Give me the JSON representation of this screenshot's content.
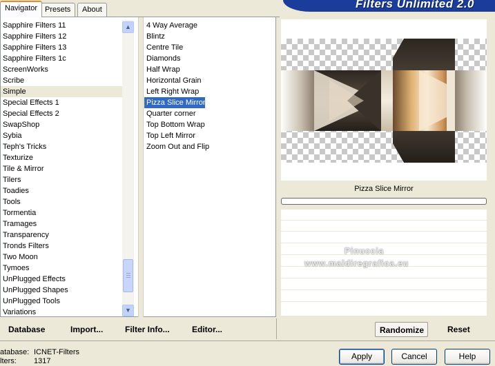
{
  "window": {
    "title": "Filters Unlimited 2.0"
  },
  "tabs": [
    {
      "label": "Navigator",
      "active": true
    },
    {
      "label": "Presets",
      "active": false
    },
    {
      "label": "About",
      "active": false
    }
  ],
  "categories": [
    "Sapphire Filters 11",
    "Sapphire Filters 12",
    "Sapphire Filters 13",
    "Sapphire Filters 1c",
    "ScreenWorks",
    "Scribe",
    "Simple",
    "Special Effects 1",
    "Special Effects 2",
    "SwapShop",
    "Sybia",
    "Teph's Tricks",
    "Texturize",
    "Tile & Mirror",
    "Tilers",
    "Toadies",
    "Tools",
    "Tormentia",
    "Tramages",
    "Transparency",
    "Tronds Filters",
    "Two Moon",
    "Tymoes",
    "UnPlugged Effects",
    "UnPlugged Shapes",
    "UnPlugged Tools",
    "Variations"
  ],
  "selected_category": "Simple",
  "filters": [
    "4 Way Average",
    "Blintz",
    "Centre Tile",
    "Diamonds",
    "Half Wrap",
    "Horizontal Grain",
    "Left Right Wrap",
    "Pizza Slice Mirror",
    "Quarter corner",
    "Top Bottom Wrap",
    "Top Left Mirror",
    "Zoom Out and Flip"
  ],
  "selected_filter": "Pizza Slice Mirror",
  "preview": {
    "filter_name": "Pizza Slice Mirror"
  },
  "watermark": {
    "line1": "Pinuccia",
    "line2": "www.maldiregrafica.eu"
  },
  "toolbar": {
    "database": "Database",
    "import": "Import...",
    "filter_info": "Filter Info...",
    "editor": "Editor...",
    "randomize": "Randomize",
    "reset": "Reset"
  },
  "status": {
    "database_label": "atabase:",
    "database_value": "ICNET-Filters",
    "filters_label": "lters:",
    "filters_value": "1317"
  },
  "buttons": {
    "apply": "Apply",
    "cancel": "Cancel",
    "help": "Help"
  },
  "icons": {
    "scroll_up": "chevron-up-icon",
    "scroll_down": "chevron-down-icon"
  }
}
